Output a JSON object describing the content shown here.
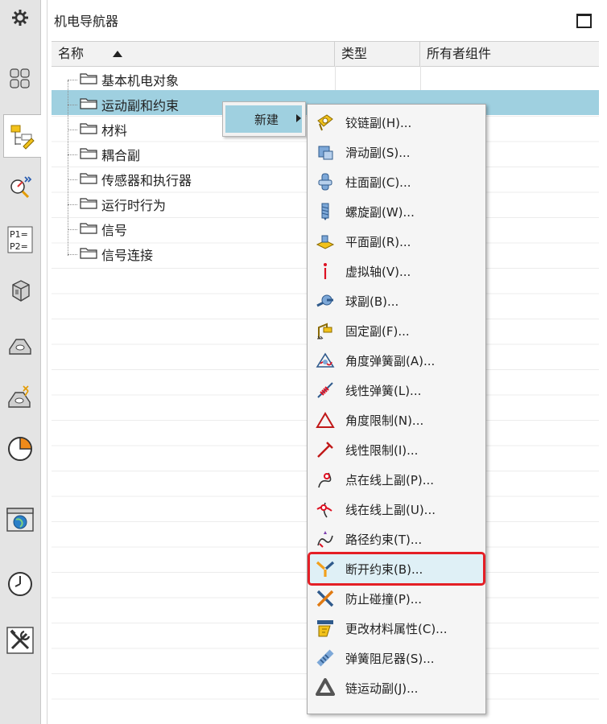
{
  "navigator": {
    "title": "机电导航器",
    "columns": {
      "name": "名称",
      "type": "类型",
      "owner": "所有者组件"
    },
    "tree_items": [
      "基本机电对象",
      "运动副和约束",
      "材料",
      "耦合副",
      "传感器和执行器",
      "运行时行为",
      "信号",
      "信号连接"
    ],
    "selected_item": "运动副和约束"
  },
  "left_toolbar": {
    "icons": [
      "settings-icon",
      "assembly-icon",
      "mechatronics-navigator-icon",
      "sensor-tracking-icon",
      "parameter-icon",
      "part-icon",
      "body-icon",
      "collision-body-icon",
      "sector-chart-icon",
      "browser-icon",
      "clock-icon",
      "tools-icon"
    ]
  },
  "context_menu": {
    "new_label": "新建"
  },
  "submenu": {
    "items": [
      {
        "label": "铰链副(H)...",
        "icon": "hinge-joint-icon"
      },
      {
        "label": "滑动副(S)...",
        "icon": "sliding-joint-icon"
      },
      {
        "label": "柱面副(C)...",
        "icon": "cylindrical-joint-icon"
      },
      {
        "label": "螺旋副(W)...",
        "icon": "screw-joint-icon"
      },
      {
        "label": "平面副(R)...",
        "icon": "planar-joint-icon"
      },
      {
        "label": "虚拟轴(V)...",
        "icon": "virtual-axis-icon"
      },
      {
        "label": "球副(B)...",
        "icon": "ball-joint-icon"
      },
      {
        "label": "固定副(F)...",
        "icon": "fixed-joint-icon"
      },
      {
        "label": "角度弹簧副(A)...",
        "icon": "angular-spring-icon"
      },
      {
        "label": "线性弹簧(L)...",
        "icon": "linear-spring-icon"
      },
      {
        "label": "角度限制(N)...",
        "icon": "angular-limit-icon"
      },
      {
        "label": "线性限制(I)...",
        "icon": "linear-limit-icon"
      },
      {
        "label": "点在线上副(P)...",
        "icon": "point-on-curve-icon"
      },
      {
        "label": "线在线上副(U)...",
        "icon": "curve-on-curve-icon"
      },
      {
        "label": "路径约束(T)...",
        "icon": "path-constraint-icon"
      },
      {
        "label": "断开约束(B)...",
        "icon": "breaking-constraint-icon"
      },
      {
        "label": "防止碰撞(P)...",
        "icon": "prevent-collision-icon"
      },
      {
        "label": "更改材料属性(C)...",
        "icon": "change-material-icon"
      },
      {
        "label": "弹簧阻尼器(S)...",
        "icon": "spring-damper-icon"
      },
      {
        "label": "链运动副(J)...",
        "icon": "chain-joint-icon"
      }
    ],
    "highlighted_item": "断开约束(B)..."
  },
  "colors": {
    "selection": "#9fd0e0",
    "highlight_border": "#e41f26",
    "toolbar_bg": "#e4e4e4"
  }
}
